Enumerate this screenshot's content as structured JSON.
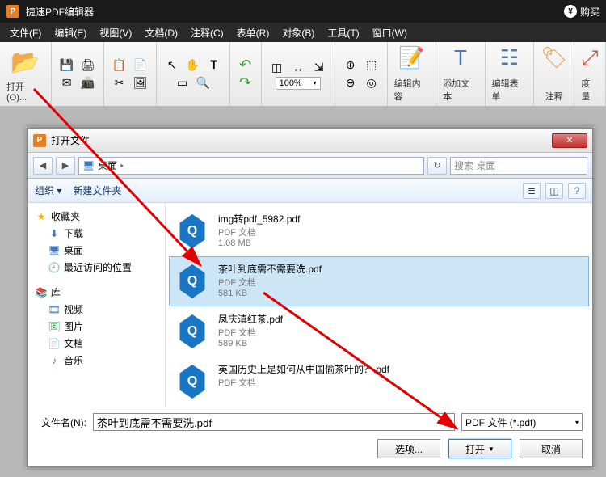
{
  "titlebar": {
    "app_name": "捷速PDF编辑器",
    "buy": "购买"
  },
  "menu": [
    "文件(F)",
    "编辑(E)",
    "视图(V)",
    "文档(D)",
    "注释(C)",
    "表单(R)",
    "对象(B)",
    "工具(T)",
    "窗口(W)"
  ],
  "ribbon": {
    "open": "打开(O)...",
    "zoom_value": "100%",
    "edit_content": "编辑内容",
    "add_text": "添加文本",
    "edit_form": "编辑表单",
    "annotate": "注释",
    "measure": "度量"
  },
  "dialog": {
    "title": "打开文件",
    "breadcrumb_desktop": "桌面",
    "search_placeholder": "搜索 桌面",
    "toolbar_organize": "组织",
    "toolbar_newfolder": "新建文件夹",
    "sidebar": {
      "favorites": "收藏夹",
      "downloads": "下载",
      "desktop": "桌面",
      "recent": "最近访问的位置",
      "library": "库",
      "videos": "视频",
      "pictures": "图片",
      "documents": "文档",
      "music": "音乐"
    },
    "files": [
      {
        "name": "img转pdf_5982.pdf",
        "type": "PDF 文档",
        "size": "1.08 MB",
        "selected": false
      },
      {
        "name": "茶叶到底需不需要洗.pdf",
        "type": "PDF 文档",
        "size": "581 KB",
        "selected": true
      },
      {
        "name": "凤庆滇红茶.pdf",
        "type": "PDF 文档",
        "size": "589 KB",
        "selected": false
      },
      {
        "name": "英国历史上是如何从中国偷茶叶的？.pdf",
        "type": "PDF 文档",
        "size": "",
        "selected": false
      }
    ],
    "filename_label": "文件名(N):",
    "filename_value": "茶叶到底需不需要洗.pdf",
    "filter": "PDF 文件 (*.pdf)",
    "options_btn": "选项...",
    "open_btn": "打开",
    "cancel_btn": "取消"
  }
}
